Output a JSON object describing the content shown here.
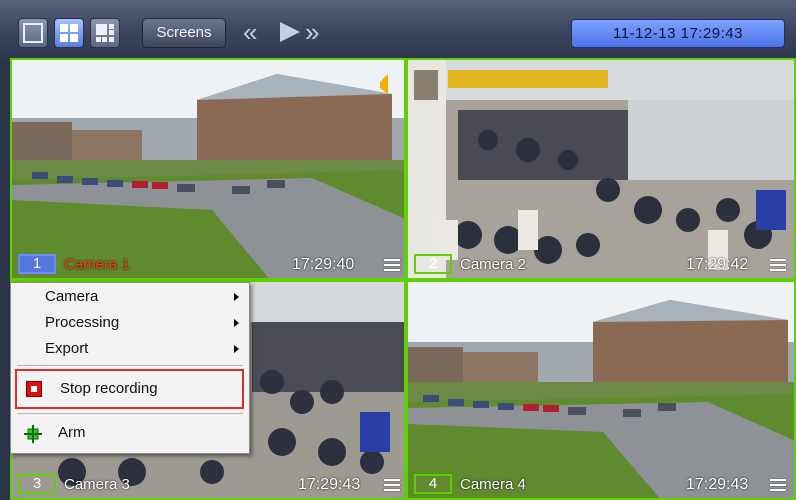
{
  "toolbar": {
    "screens_label": "Screens",
    "datetime": "11-12-13  17:29:43",
    "layout_buttons": [
      "single-view-icon",
      "grid-2x2-icon",
      "grid-multi-icon"
    ],
    "nav_icons": [
      "rewind-icon",
      "play-icon",
      "fast-forward-icon"
    ]
  },
  "cameras": [
    {
      "number": "1",
      "name": "Camera 1",
      "time": "17:29:40",
      "selected": true,
      "name_color": "#ff3b1f"
    },
    {
      "number": "2",
      "name": "Camera 2",
      "time": "17:29:42",
      "selected": false
    },
    {
      "number": "3",
      "name": "Camera 3",
      "time": "17:29:43",
      "selected": false
    },
    {
      "number": "4",
      "name": "Camera 4",
      "time": "17:29:43",
      "selected": false
    }
  ],
  "context_menu": {
    "items": [
      {
        "label": "Camera",
        "submenu": true
      },
      {
        "label": "Processing",
        "submenu": true
      },
      {
        "label": "Export",
        "submenu": true
      }
    ],
    "stop_recording": "Stop recording",
    "arm": "Arm"
  },
  "colors": {
    "tile_border": "#5fd000",
    "datetime_bg": "#5a7ef0",
    "highlight_red": "#e22b2b"
  }
}
